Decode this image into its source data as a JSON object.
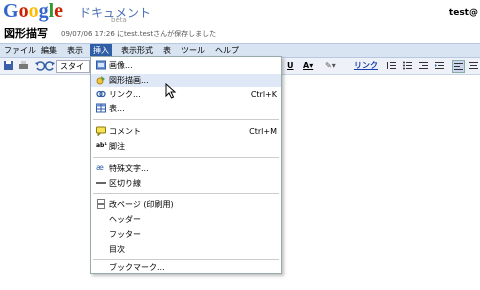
{
  "header": {
    "logo_letters": [
      {
        "ch": "G",
        "color": "#3366cc"
      },
      {
        "ch": "o",
        "color": "#cc2200"
      },
      {
        "ch": "o",
        "color": "#ffbb00"
      },
      {
        "ch": "g",
        "color": "#3366cc"
      },
      {
        "ch": "l",
        "color": "#339933"
      },
      {
        "ch": "e",
        "color": "#cc2200"
      }
    ],
    "product": "ドキュメント",
    "beta": "beta",
    "user": "test@",
    "doc_title": "図形描写",
    "save_status": "09/07/06 17:26 にtest.testさんが保存しました"
  },
  "menubar": {
    "items": [
      "ファイル",
      "編集",
      "表示",
      "挿入",
      "表示形式",
      "表",
      "ツール",
      "ヘルプ"
    ],
    "active": "挿入"
  },
  "toolbar": {
    "style_label": "スタイ",
    "link_label": "リンク"
  },
  "insert_menu": {
    "items": [
      {
        "label": "画像...",
        "icon": "image-icon",
        "shortcut": ""
      },
      {
        "label": "図形描画...",
        "icon": "drawing-icon",
        "shortcut": "",
        "hover": true
      },
      {
        "label": "リンク...",
        "icon": "link-icon",
        "shortcut": "Ctrl+K"
      },
      {
        "label": "表...",
        "icon": "table-icon",
        "shortcut": ""
      },
      {
        "label": "コメント",
        "icon": "comment-icon",
        "shortcut": "Ctrl+M"
      },
      {
        "label": "脚注",
        "icon": "footnote-icon",
        "shortcut": ""
      },
      {
        "label": "特殊文字...",
        "icon": "special-char-icon",
        "shortcut": ""
      },
      {
        "label": "区切り線",
        "icon": "horizontal-line-icon",
        "shortcut": ""
      },
      {
        "label": "改ページ (印刷用)",
        "icon": "page-break-icon",
        "shortcut": ""
      },
      {
        "label": "ヘッダー",
        "icon": "",
        "shortcut": ""
      },
      {
        "label": "フッター",
        "icon": "",
        "shortcut": ""
      },
      {
        "label": "目次",
        "icon": "",
        "shortcut": ""
      },
      {
        "label": "ブックマーク...",
        "icon": "",
        "shortcut": ""
      }
    ]
  },
  "colors": {
    "menubar_bg": "#d9e4f3",
    "menu_active": "#2f5ea6",
    "hover_bg": "#dfe8f6"
  }
}
